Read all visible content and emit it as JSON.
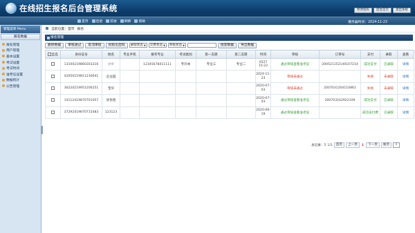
{
  "app": {
    "title": "在线招生报名后台管理系统"
  },
  "top_links": [
    "修改密码",
    "后台首页",
    "退出系统"
  ],
  "nav": [
    {
      "icon": "home-icon",
      "label": "首页"
    },
    {
      "icon": "back-icon",
      "label": "后退"
    },
    {
      "icon": "forward-icon",
      "label": "前进"
    },
    {
      "icon": "refresh-icon",
      "label": "刷新"
    },
    {
      "icon": "help-icon",
      "label": "帮助"
    }
  ],
  "date": "服务器时间：2024-11-23",
  "sidebar": {
    "header": "管理菜单 Menu",
    "sub": "报名数据",
    "items": [
      {
        "label": "报名管理"
      },
      {
        "label": "用户管理"
      },
      {
        "label": "基本设置"
      },
      {
        "label": "考试设置"
      },
      {
        "label": "考试时间"
      },
      {
        "label": "准考证设置"
      },
      {
        "label": "数据统计"
      },
      {
        "label": "公告管理"
      }
    ]
  },
  "breadcrumb": [
    "当前位置：首页",
    "报名"
  ],
  "panel_title": "报名管理",
  "toolbar": {
    "buttons": [
      "删除数据",
      "审核通过",
      "取消审核",
      "初始化密码"
    ],
    "filters": [
      "录取状态",
      "交费状态",
      "审核状态"
    ],
    "search_button": "搜索数据",
    "export_button": "导出数据"
  },
  "table": {
    "headers": [
      "全选",
      "身份证号",
      "姓名",
      "专业手机",
      "报考专业",
      "考试类别",
      "第一志愿",
      "第二志愿",
      "时间",
      "审核",
      "订单号",
      "支付",
      "录取",
      "查看"
    ],
    "rows": [
      {
        "id": "13100219860303216",
        "name": "少少",
        "phone": "",
        "major": "12345678411111",
        "category": "专升本",
        "first": "专业三",
        "second": "专业二",
        "time": "0527 15:22",
        "review": "通过审核查看准考证",
        "order": "200521152140107214",
        "pay": "成功支付",
        "admit": "已录取",
        "view": "详情"
      },
      {
        "id": "42050219811230641",
        "name": "企业园",
        "phone": "",
        "major": "",
        "category": "",
        "first": "",
        "second": "",
        "time": "2024-11-23",
        "review": "审核未通过",
        "order": "",
        "pay": "失败",
        "admit": "未录取",
        "view": "详情"
      },
      {
        "id": "36220219951206251",
        "name": "宝华",
        "phone": "",
        "major": "",
        "category": "",
        "first": "",
        "second": "",
        "time": "2020-07-03",
        "review": "审核未通过",
        "order": "2007031204110861",
        "pay": "失败",
        "admit": "未录取",
        "view": "详情"
      },
      {
        "id": "14112419870701057",
        "name": "优优哈",
        "phone": "",
        "major": "",
        "category": "",
        "first": "",
        "second": "",
        "time": "2020-07-03",
        "review": "通过审核查看准考证",
        "order": "200703162922109",
        "pay": "成功支付",
        "admit": "已录取",
        "view": "详情"
      },
      {
        "id": "37292419870715483",
        "name": "123123",
        "phone": "",
        "major": "",
        "category": "",
        "first": "",
        "second": "",
        "time": "2020-06-19",
        "review": "通过审核查看准考证",
        "order": "",
        "pay": "成功支付费",
        "admit": "已录取",
        "view": "详情"
      }
    ]
  },
  "pager": {
    "count_label": "总记录：5",
    "page_label": "1/1",
    "first": "首页",
    "prev": "上一页",
    "current": "1",
    "next": "下一页",
    "last": "尾页",
    "page_input": "1"
  },
  "colors": {
    "header": "#0e3f6e",
    "success": "#2d9a2d",
    "danger": "#d43a2a",
    "link": "#2a6bb3"
  }
}
